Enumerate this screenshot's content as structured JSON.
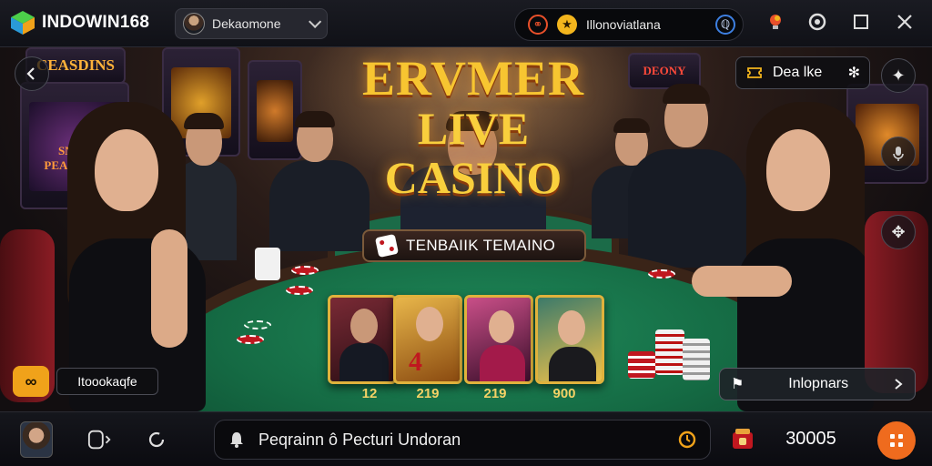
{
  "app": {
    "name": "INDOWIN168"
  },
  "header": {
    "profile_name": "Dekaomone",
    "status_text": "Illonoviatlana"
  },
  "scene": {
    "title_top": "ERVMER",
    "title_bottom": "LIVE CASINO",
    "banner": "TENBAIIK TEMAINO",
    "slot_signs": [
      "CEASDINS",
      "SNOY PEASAIINI",
      "DEONY"
    ],
    "bookmark_label": "Dea lke",
    "left_chip_label": "Itoookaqfe",
    "info_label": "Inlopnars",
    "cards": [
      {
        "value": "12",
        "accent": "#7a2a35"
      },
      {
        "value": "219",
        "accent": "#e8b64a"
      },
      {
        "value": "219",
        "accent": "#c94f88"
      },
      {
        "value": "900",
        "accent": "#3c7a6a"
      }
    ]
  },
  "footer": {
    "search_text": "Peqrainn ô Pecturi Undoran",
    "balance": "30005"
  },
  "colors": {
    "accent_orange": "#ef6b1e",
    "gold": "#f7c531",
    "felt": "#1f8a5a"
  },
  "icons": {
    "bulb": "lightbulb-icon",
    "record": "record-icon",
    "maximize": "maximize-icon",
    "close": "close-icon"
  }
}
